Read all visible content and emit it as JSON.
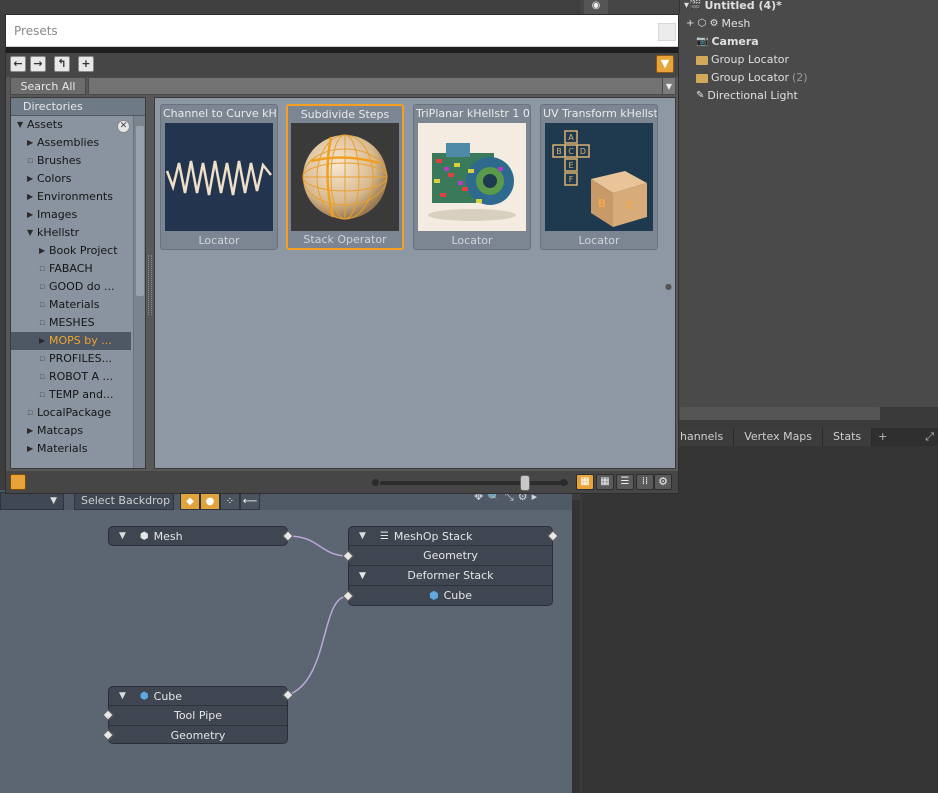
{
  "scene": {
    "items": [
      {
        "label": "Untitled (4)*",
        "icon": "scene-icon",
        "bold": true
      },
      {
        "label": "Mesh",
        "icon": "mesh-icon"
      },
      {
        "label": "Camera",
        "icon": "camera-icon",
        "bold": true
      },
      {
        "label": "Group Locator",
        "icon": "folder-icon"
      },
      {
        "label": "Group Locator",
        "icon": "folder-icon",
        "suffix": "(2)"
      },
      {
        "label": "Directional Light",
        "icon": "light-icon"
      }
    ]
  },
  "bottom_tabs": [
    "hannels",
    "Vertex Maps",
    "Stats"
  ],
  "graph": {
    "select_backdrop": "Select Backdrop",
    "nodes": {
      "mesh": {
        "title": "Mesh"
      },
      "meshop": {
        "title": "MeshOp Stack",
        "rows": [
          "Geometry",
          "Deformer Stack",
          "Cube"
        ]
      },
      "cube": {
        "title": "Cube",
        "rows": [
          "Tool Pipe",
          "Geometry"
        ]
      }
    }
  },
  "presets": {
    "title": "Presets",
    "search_label": "Search All",
    "search_value": "",
    "directories_header": "Directories",
    "directories": [
      {
        "label": "Assets",
        "level": 0,
        "expander": "open"
      },
      {
        "label": "Assemblies",
        "level": 1,
        "expander": "closed"
      },
      {
        "label": "Brushes",
        "level": 1,
        "expander": "none"
      },
      {
        "label": "Colors",
        "level": 1,
        "expander": "closed"
      },
      {
        "label": "Environments",
        "level": 1,
        "expander": "closed"
      },
      {
        "label": "Images",
        "level": 1,
        "expander": "closed"
      },
      {
        "label": "kHellstr",
        "level": 1,
        "expander": "open"
      },
      {
        "label": "Book Project",
        "level": 2,
        "expander": "closed"
      },
      {
        "label": "FABACH",
        "level": 2,
        "expander": "none"
      },
      {
        "label": "GOOD do ...",
        "level": 2,
        "expander": "none"
      },
      {
        "label": "Materials",
        "level": 2,
        "expander": "none"
      },
      {
        "label": "MESHES",
        "level": 2,
        "expander": "none"
      },
      {
        "label": "MOPS by ...",
        "level": 2,
        "expander": "closed",
        "selected": true
      },
      {
        "label": "PROFILES...",
        "level": 2,
        "expander": "none"
      },
      {
        "label": "ROBOT A ...",
        "level": 2,
        "expander": "none"
      },
      {
        "label": "TEMP and...",
        "level": 2,
        "expander": "none"
      },
      {
        "label": "LocalPackage",
        "level": 1,
        "expander": "none"
      },
      {
        "label": "Matcaps",
        "level": 1,
        "expander": "closed"
      },
      {
        "label": "Materials",
        "level": 1,
        "expander": "closed"
      }
    ],
    "cards": [
      {
        "title": "Channel to Curve kH...",
        "type": "Locator",
        "image": "waveform-thumbnail"
      },
      {
        "title": "Subdivide Steps",
        "type": "Stack Operator",
        "image": "subdivided-sphere-thumbnail",
        "selected": true
      },
      {
        "title": "TriPlanar kHellstr 1 0",
        "type": "Locator",
        "image": "triplanar-camera-thumbnail"
      },
      {
        "title": "UV Transform kHellstr",
        "type": "Locator",
        "image": "uv-cube-thumbnail"
      }
    ],
    "thumbnail_size": 0.77
  },
  "colors": {
    "accent": "#f5a020",
    "selection_text": "#f0a430",
    "graph_bg": "#5c6672"
  }
}
